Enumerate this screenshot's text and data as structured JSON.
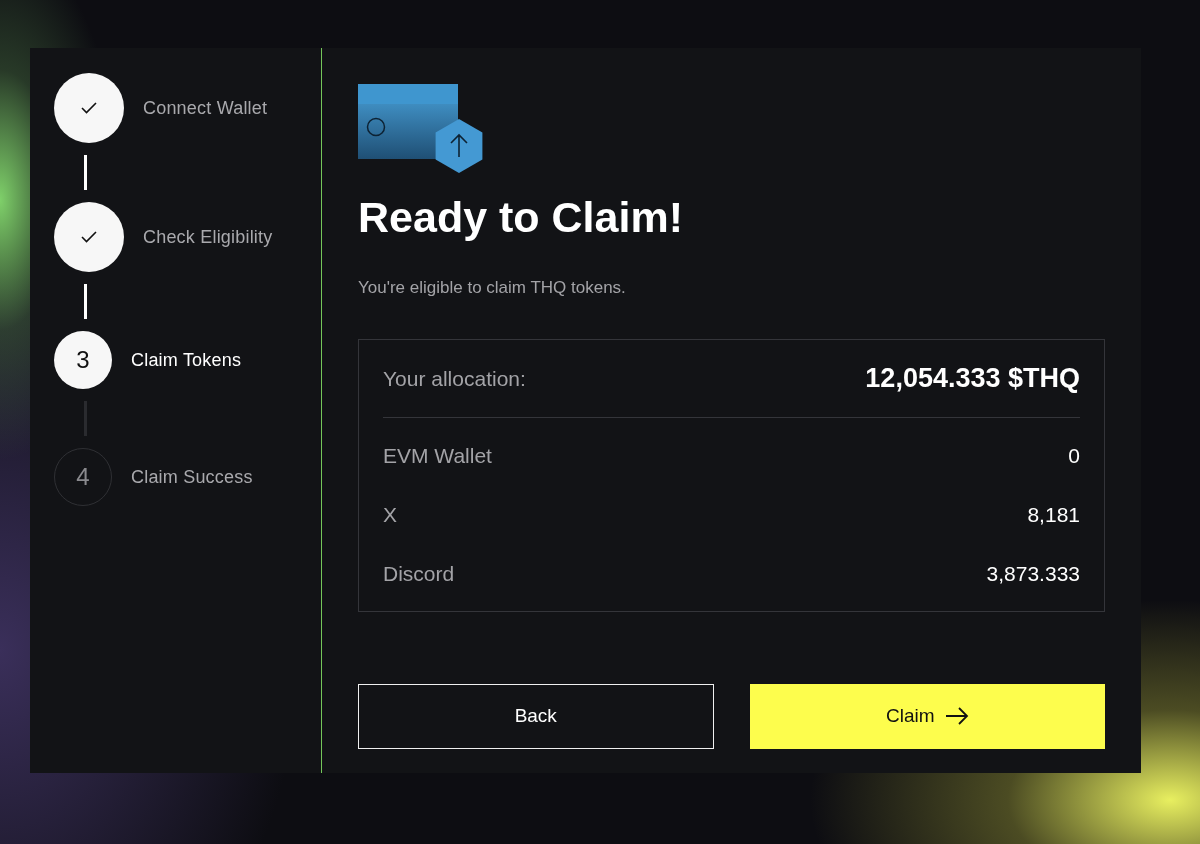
{
  "steps": [
    {
      "label": "Connect Wallet",
      "done": true,
      "selected": false
    },
    {
      "label": "Check Eligibility",
      "done": true,
      "selected": false
    },
    {
      "label": "Claim Tokens",
      "done": false,
      "selected": true,
      "number": "3"
    },
    {
      "label": "Claim Success",
      "done": false,
      "selected": false,
      "number": "4"
    }
  ],
  "heading": "Ready to Claim!",
  "subtitle": "You're eligible to claim THQ tokens.",
  "allocation": {
    "label": "Your allocation:",
    "value": "12,054.333 $THQ"
  },
  "sources": [
    {
      "label": "EVM Wallet",
      "value": "0"
    },
    {
      "label": "X",
      "value": "8,181"
    },
    {
      "label": "Discord",
      "value": "3,873.333"
    }
  ],
  "buttons": [
    {
      "label": "Back",
      "kind": "outline"
    },
    {
      "label": "Claim",
      "kind": "primary"
    }
  ]
}
